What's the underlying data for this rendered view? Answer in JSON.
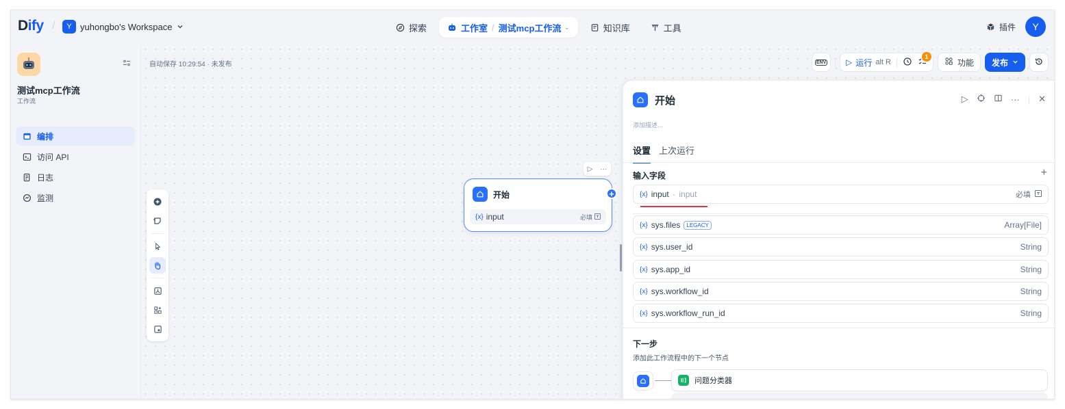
{
  "header": {
    "logo_text": "Dify",
    "workspace_initial": "Y",
    "workspace_name": "yuhongbo's Workspace",
    "nav": {
      "explore": "探索",
      "studio": "工作室",
      "current_app": "测试mcp工作流",
      "knowledge": "知识库",
      "tools": "工具"
    },
    "plugins": "插件",
    "avatar_initial": "Y"
  },
  "sidebar": {
    "app_name": "测试mcp工作流",
    "app_type": "工作流",
    "items": [
      {
        "label": "编排",
        "icon": "layout-icon"
      },
      {
        "label": "访问 API",
        "icon": "terminal-icon"
      },
      {
        "label": "日志",
        "icon": "log-icon"
      },
      {
        "label": "监测",
        "icon": "monitor-icon"
      }
    ]
  },
  "canvas": {
    "autosave": "自动保存 10:29:54 · 未发布",
    "node": {
      "title": "开始",
      "var_name": "input",
      "required": "必填"
    }
  },
  "toolbar": {
    "env": "ENV",
    "run": "运行",
    "run_shortcut": "alt  R",
    "checklist_badge": "1",
    "features": "功能",
    "publish": "发布"
  },
  "panel": {
    "title": "开始",
    "desc_placeholder": "添加描述...",
    "tabs": [
      "设置",
      "上次运行"
    ],
    "input_section": "输入字段",
    "user_var": {
      "name": "input",
      "label": "input",
      "required": "必填"
    },
    "sys_vars": [
      {
        "name": "sys.files",
        "badge": "LEGACY",
        "type": "Array[File]"
      },
      {
        "name": "sys.user_id",
        "type": "String"
      },
      {
        "name": "sys.app_id",
        "type": "String"
      },
      {
        "name": "sys.workflow_id",
        "type": "String"
      },
      {
        "name": "sys.workflow_run_id",
        "type": "String"
      }
    ],
    "next_title": "下一步",
    "next_desc": "添加此工作流程中的下一个节点",
    "next_node": "问题分类器"
  },
  "colors": {
    "accent": "#155eef",
    "canvas_bg": "#f2f4f7",
    "underline": "#e5323f",
    "badge": "#f79009",
    "classifier": "#16b364"
  }
}
